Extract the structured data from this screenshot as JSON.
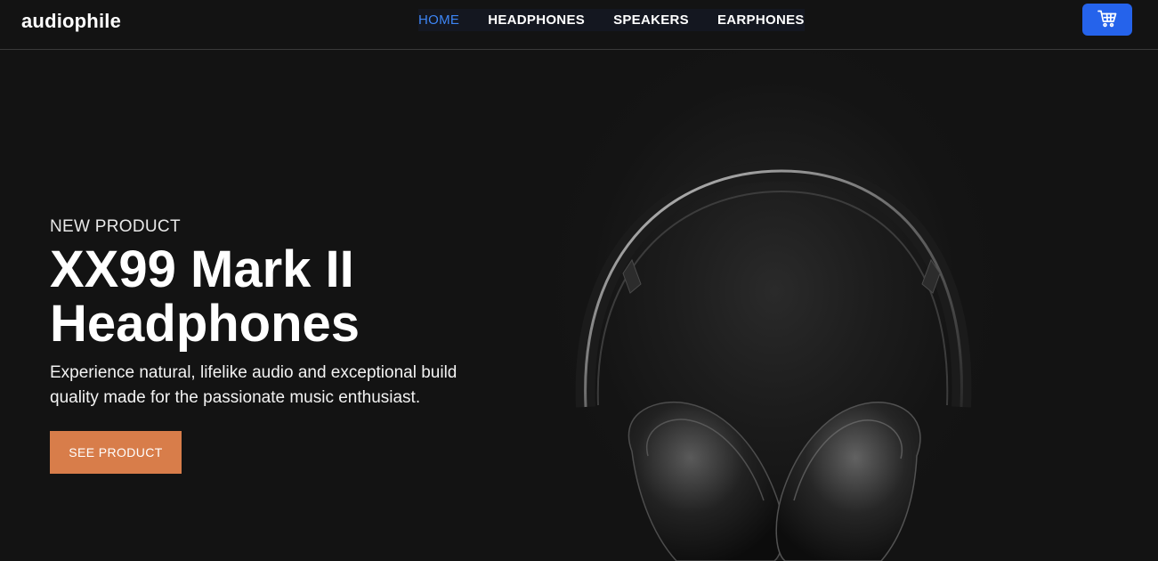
{
  "header": {
    "logo": "audiophile",
    "nav": [
      {
        "label": "HOME",
        "active": true
      },
      {
        "label": "HEADPHONES",
        "active": false
      },
      {
        "label": "SPEAKERS",
        "active": false
      },
      {
        "label": "EARPHONES",
        "active": false
      }
    ],
    "cart_icon": "cart-icon"
  },
  "hero": {
    "eyebrow": "NEW PRODUCT",
    "title_line1": "XX99 Mark II",
    "title_line2": "Headphones",
    "description": "Experience natural, lifelike audio and exceptional build quality made for the passionate music enthusiast.",
    "cta_label": "SEE PRODUCT",
    "image": "headphones-image"
  },
  "colors": {
    "background": "#131313",
    "nav_active": "#3d85f5",
    "cart_button": "#2563eb",
    "cta": "#d87d4a"
  }
}
